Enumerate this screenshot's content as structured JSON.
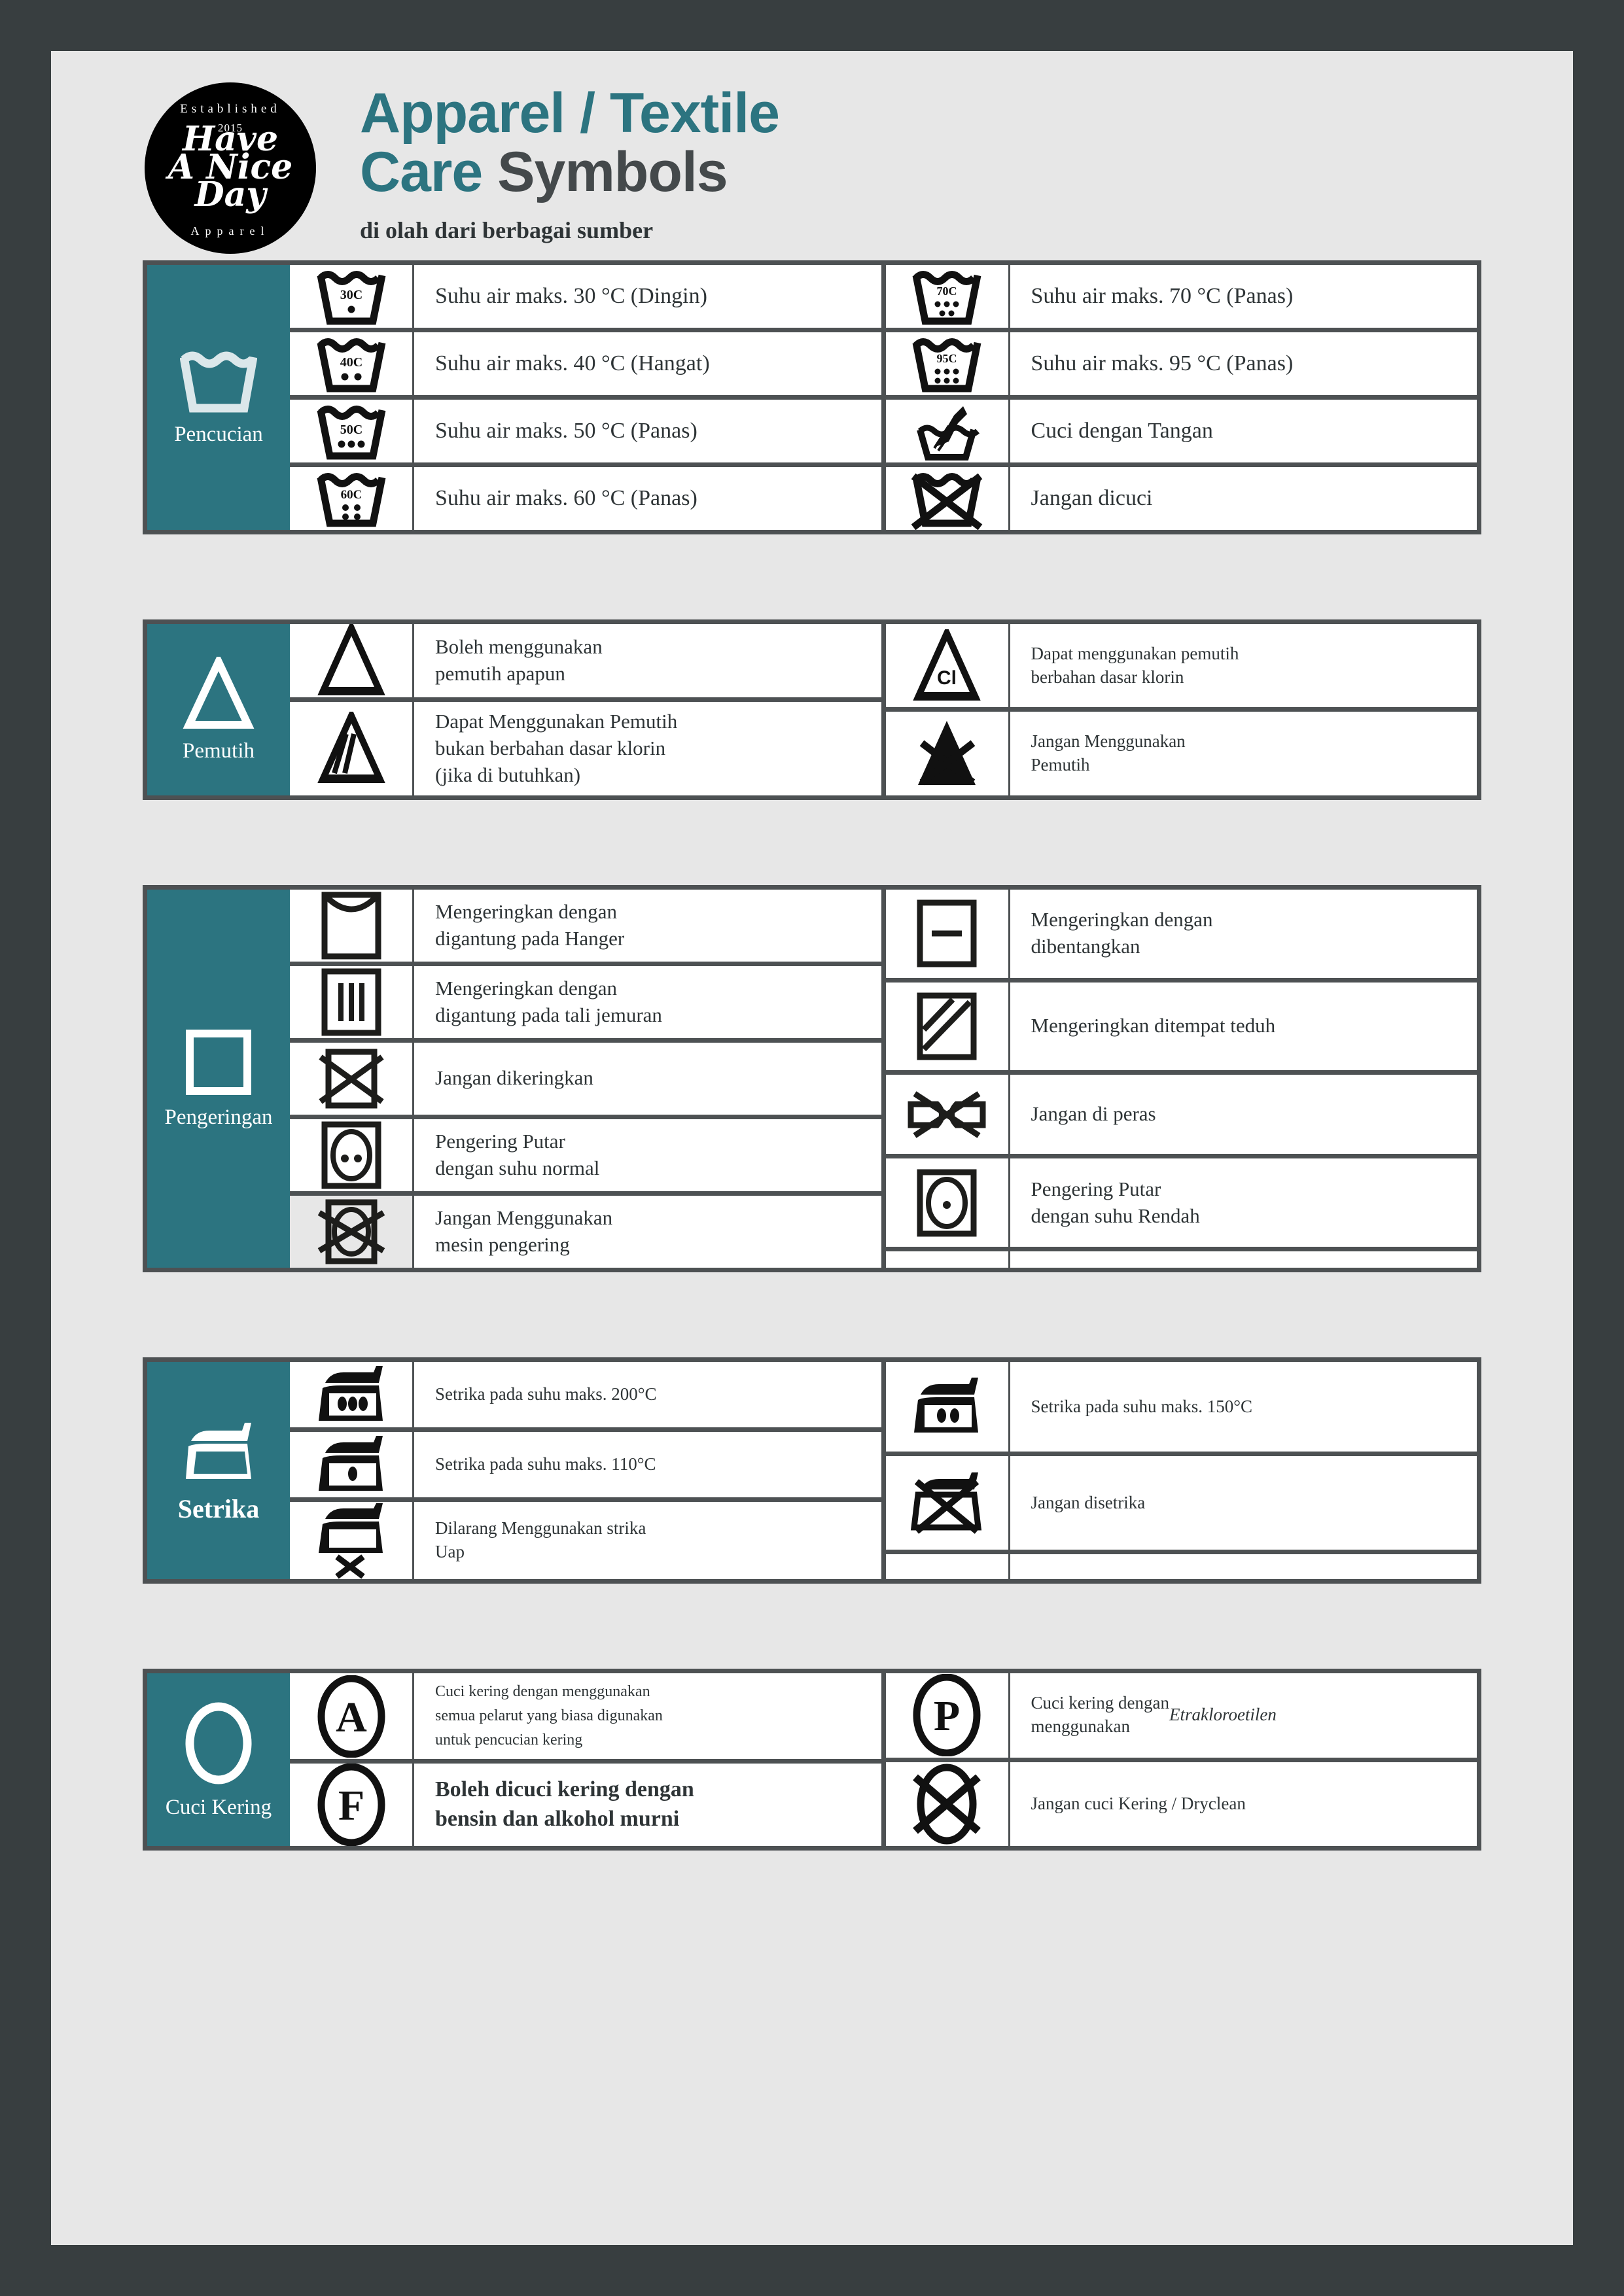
{
  "logo": {
    "established": "Established",
    "year": "2015",
    "script_lines": [
      "Have",
      "A Nice",
      "Day"
    ],
    "apparel": "Apparel"
  },
  "header": {
    "title_line1_teal": "Apparel / Textile",
    "title_line2_teal": "Care ",
    "title_line2_dark": "Symbols",
    "subtitle": "di olah dari berbagai sumber"
  },
  "colors": {
    "teal": "#2c7480",
    "page_bg": "#e7e7e7",
    "frame": "#383e40",
    "border": "#4d5153",
    "text": "#2e3436"
  },
  "sections": [
    {
      "id": "pencucian",
      "category_label": "Pencucian",
      "category_icon": "wash-tub-icon",
      "left_rows": [
        {
          "icon": "wash-30c-icon",
          "icon_text": "30C",
          "text": "Suhu air maks. 30 °C (Dingin)"
        },
        {
          "icon": "wash-40c-icon",
          "icon_text": "40C",
          "text": "Suhu air maks. 40 °C (Hangat)"
        },
        {
          "icon": "wash-50c-icon",
          "icon_text": "50C",
          "text": "Suhu air maks. 50 °C (Panas)"
        },
        {
          "icon": "wash-60c-icon",
          "icon_text": "60C",
          "text": "Suhu air maks. 60 °C (Panas)"
        }
      ],
      "right_rows": [
        {
          "icon": "wash-70c-icon",
          "icon_text": "70C",
          "text": "Suhu air maks. 70 °C (Panas)"
        },
        {
          "icon": "wash-95c-icon",
          "icon_text": "95C",
          "text": "Suhu air maks. 95 °C (Panas)"
        },
        {
          "icon": "hand-wash-icon",
          "icon_text": "",
          "text": "Cuci dengan Tangan"
        },
        {
          "icon": "do-not-wash-icon",
          "icon_text": "",
          "text": "Jangan dicuci"
        }
      ]
    },
    {
      "id": "pemutih",
      "category_label": "Pemutih",
      "category_icon": "triangle-bleach-icon",
      "left_rows": [
        {
          "icon": "bleach-any-icon",
          "text": "Boleh menggunakan\npemutih apapun"
        },
        {
          "icon": "bleach-non-chlorine-icon",
          "text": "Dapat Menggunakan Pemutih\nbukan berbahan dasar klorin\n(jika di butuhkan)"
        }
      ],
      "right_rows": [
        {
          "icon": "bleach-chlorine-cl-icon",
          "text": "Dapat menggunakan pemutih\nberbahan dasar klorin"
        },
        {
          "icon": "do-not-bleach-icon",
          "text": "Jangan Menggunakan\nPemutih"
        }
      ]
    },
    {
      "id": "pengeringan",
      "category_label": "Pengeringan",
      "category_icon": "square-dry-icon",
      "left_rows": [
        {
          "icon": "drip-dry-hanger-icon",
          "text": "Mengeringkan dengan\ndigantung pada Hanger"
        },
        {
          "icon": "line-dry-icon",
          "text": "Mengeringkan dengan\ndigantung pada tali jemuran"
        },
        {
          "icon": "do-not-dry-icon",
          "text": "Jangan dikeringkan"
        },
        {
          "icon": "tumble-dry-normal-icon",
          "text": "Pengering Putar\ndengan suhu normal"
        },
        {
          "icon": "do-not-tumble-dry-icon",
          "shaded": true,
          "text": "Jangan Menggunakan\nmesin pengering"
        }
      ],
      "right_rows": [
        {
          "icon": "flat-dry-icon",
          "text": "Mengeringkan dengan\ndibentangkan"
        },
        {
          "icon": "dry-in-shade-icon",
          "text": "Mengeringkan ditempat teduh"
        },
        {
          "icon": "do-not-wring-icon",
          "text": "Jangan di peras"
        },
        {
          "icon": "tumble-dry-low-icon",
          "text": "Pengering Putar\ndengan suhu Rendah"
        },
        {
          "icon": "",
          "text": ""
        }
      ]
    },
    {
      "id": "setrika",
      "category_label": "Setrika",
      "category_icon": "iron-icon",
      "left_rows": [
        {
          "icon": "iron-3dots-icon",
          "text": "Setrika pada suhu maks. 200°C"
        },
        {
          "icon": "iron-1dot-icon",
          "text": "Setrika pada suhu maks. 110°C"
        },
        {
          "icon": "no-steam-iron-icon",
          "text": "Dilarang Menggunakan strika\nUap"
        }
      ],
      "right_rows": [
        {
          "icon": "iron-2dots-icon",
          "text": "Setrika pada suhu maks. 150°C"
        },
        {
          "icon": "do-not-iron-icon",
          "text": "Jangan disetrika"
        },
        {
          "icon": "",
          "text": ""
        }
      ]
    },
    {
      "id": "cuci-kering",
      "category_label": "Cuci Kering",
      "category_icon": "circle-dryclean-icon",
      "left_rows": [
        {
          "icon": "dryclean-a-icon",
          "icon_text": "A",
          "text": "Cuci kering dengan menggunakan\nsemua pelarut yang biasa digunakan\nuntuk pencucian kering"
        },
        {
          "icon": "dryclean-f-icon",
          "icon_text": "F",
          "text": "Boleh dicuci kering dengan\nbensin dan alkohol murni"
        }
      ],
      "right_rows": [
        {
          "icon": "dryclean-p-icon",
          "icon_text": "P",
          "text_pre": "Cuci kering dengan\nmenggunakan ",
          "text_italic": "Etrakloroetilen"
        },
        {
          "icon": "do-not-dryclean-icon",
          "text": "Jangan cuci Kering / Dryclean"
        }
      ]
    }
  ]
}
